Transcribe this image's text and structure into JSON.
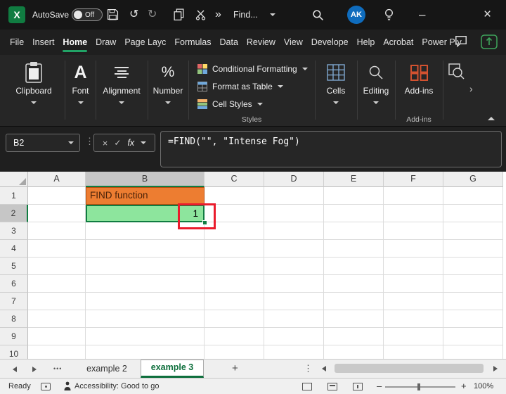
{
  "colors": {
    "excel_green": "#107C41",
    "menu_active_underline": "#21A366",
    "titlebar_bg": "#161616",
    "ribbon_bg": "#262626",
    "cell_fill_orange": "#ED7D31",
    "cell_fill_green": "#8DE59D",
    "annotation_red": "#EA1C2C",
    "avatar_blue": "#0F6CBD"
  },
  "titlebar": {
    "autosave_label": "AutoSave",
    "autosave_state": "Off",
    "undo_glyph": "↺",
    "redo_glyph": "↻",
    "overflow_glyph": "»",
    "find_label": "Find...",
    "avatar_initials": "AK",
    "minimize_glyph": "–",
    "close_glyph": "×"
  },
  "menubar": {
    "items": [
      "File",
      "Insert",
      "Home",
      "Draw",
      "Page Layc",
      "Formulas",
      "Data",
      "Review",
      "View",
      "Develope",
      "Help",
      "Acrobat",
      "Power Piv"
    ],
    "active_item": "Home"
  },
  "ribbon": {
    "clipboard_label": "Clipboard",
    "font_label": "Font",
    "font_glyph": "A",
    "alignment_label": "Alignment",
    "number_label": "Number",
    "number_glyph": "%",
    "styles": {
      "caption": "Styles",
      "items": [
        "Conditional Formatting",
        "Format as Table",
        "Cell Styles"
      ]
    },
    "cells_label": "Cells",
    "editing_label": "Editing",
    "addins_label": "Add-ins",
    "addins_caption": "Add-ins",
    "more_glyph": "›"
  },
  "formula_bar": {
    "name_box": "B2",
    "menu_glyph": "⋮",
    "cancel_glyph": "×",
    "enter_glyph": "✓",
    "fx_glyph": "fx",
    "formula": "=FIND(\"\", \"Intense Fog\")"
  },
  "grid": {
    "columns": [
      "A",
      "B",
      "C",
      "D",
      "E",
      "F",
      "G"
    ],
    "rows": [
      "1",
      "2",
      "3",
      "4",
      "5",
      "6",
      "7",
      "8",
      "9",
      "10"
    ],
    "cells": {
      "B1": "FIND function",
      "B2": "1"
    },
    "selected_cell": "B2"
  },
  "tabs": {
    "more_glyph": "•••",
    "sheets": [
      "example 2",
      "example 3"
    ],
    "active_sheet": "example 3",
    "add_glyph": "+",
    "menu_glyph": "⋮"
  },
  "status": {
    "ready": "Ready",
    "accessibility": "Accessibility: Good to go",
    "minus_glyph": "–",
    "plus_glyph": "+",
    "zoom": "100%"
  }
}
